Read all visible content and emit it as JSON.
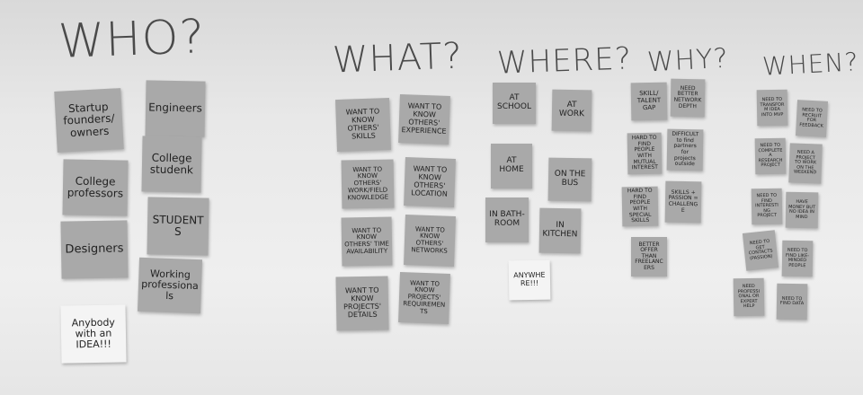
{
  "headers": {
    "who": "WHO?",
    "what": "WHAT?",
    "where": "WHERE?",
    "why": "WHY?",
    "when": "WHEN?"
  },
  "who": [
    "Startup founders/ owners",
    "Engineers",
    "College professors",
    "College studenk",
    "Designers",
    "STUDENTS",
    "Working professionals",
    "Anybody with an IDEA!!!"
  ],
  "what": [
    "WANT TO KNOW OTHERS' SKILLS",
    "WANT TO KNOW OTHERS' EXPERIENCE",
    "WANT TO KNOW OTHERS' WORK/FIELD KNOWLEDGE",
    "WANT TO KNOW OTHERS' LOCATION",
    "WANT TO KNOW OTHERS' TIME AVAILABILITY",
    "WANT TO KNOW OTHERS' NETWORKS",
    "WANT TO KNOW PROJECTS' DETAILS",
    "WANT TO KNOW PROJECTS' REQUIREMENTS"
  ],
  "where": [
    "AT SCHOOL",
    "AT WORK",
    "AT HOME",
    "ON THE BUS",
    "IN BATH-ROOM",
    "IN KITCHEN",
    "ANYWHERE!!!"
  ],
  "why": [
    "SKILL/ TALENT GAP",
    "NEED BETTER NETWORK DEPTH",
    "HARD TO FIND PEOPLE WITH MUTUAL INTEREST",
    "DIFFICULT to find partners for projects outside",
    "HARD TO FIND PEOPLE WITH SPECIAL SKILLS",
    "SKILLS + PASSION = CHALLENGE",
    "BETTER OFFER THAN FREELANCERS"
  ],
  "when": [
    "NEED TO TRANSFORM IDEA INTO MVP",
    "NEED TO RECRUIT FOR FEEDBACK",
    "NEED TO COMPLETE A RESEARCH PROJECT",
    "NEED A PROJECT TO WORK ON THE WEEKEND",
    "NEED TO FIND INTERESTING PROJECT",
    "HAVE MONEY BUT NO IDEA IN MIND",
    "NEED TO GET CONTACTS (PASSION)",
    "NEED TO FIND LIKE-MINDED PEOPLE",
    "NEED PROFESSIONAL OR EXPERT HELP",
    "NEED TO FIND DATA"
  ]
}
